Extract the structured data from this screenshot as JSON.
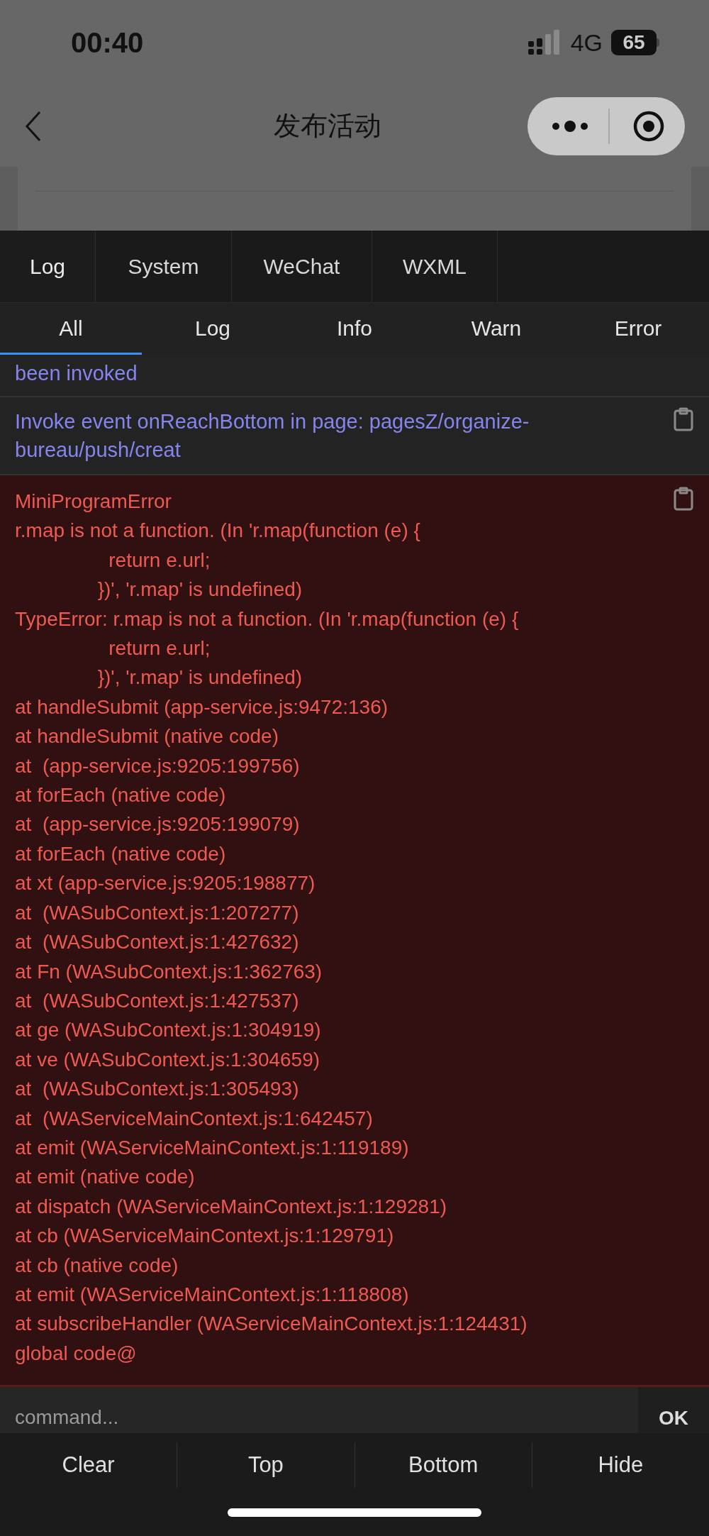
{
  "status_bar": {
    "time": "00:40",
    "network": "4G",
    "battery": "65"
  },
  "nav": {
    "title": "发布活动"
  },
  "tabs": [
    {
      "label": "Log",
      "selected": true
    },
    {
      "label": "System",
      "selected": false
    },
    {
      "label": "WeChat",
      "selected": false
    },
    {
      "label": "WXML",
      "selected": false
    }
  ],
  "filters": [
    {
      "label": "All",
      "selected": true
    },
    {
      "label": "Log",
      "selected": false
    },
    {
      "label": "Info",
      "selected": false
    },
    {
      "label": "Warn",
      "selected": false
    },
    {
      "label": "Error",
      "selected": false
    }
  ],
  "entries": [
    {
      "kind": "log",
      "text": "been invoked",
      "copy": false
    },
    {
      "kind": "log",
      "text": "Invoke event onReachBottom in page: pagesZ/organize-bureau/push/creat",
      "copy": true
    },
    {
      "kind": "error",
      "title": "MiniProgramError",
      "text": "r.map is not a function. (In 'r.map(function (e) {\n                 return e.url;\n               })', 'r.map' is undefined)\nTypeError: r.map is not a function. (In 'r.map(function (e) {\n                 return e.url;\n               })', 'r.map' is undefined)\nat handleSubmit (app-service.js:9472:136)\nat handleSubmit (native code)\nat  (app-service.js:9205:199756)\nat forEach (native code)\nat  (app-service.js:9205:199079)\nat forEach (native code)\nat xt (app-service.js:9205:198877)\nat  (WASubContext.js:1:207277)\nat  (WASubContext.js:1:427632)\nat Fn (WASubContext.js:1:362763)\nat  (WASubContext.js:1:427537)\nat ge (WASubContext.js:1:304919)\nat ve (WASubContext.js:1:304659)\nat  (WASubContext.js:1:305493)\nat  (WAServiceMainContext.js:1:642457)\nat emit (WAServiceMainContext.js:1:119189)\nat emit (native code)\nat dispatch (WAServiceMainContext.js:1:129281)\nat cb (WAServiceMainContext.js:1:129791)\nat cb (native code)\nat emit (WAServiceMainContext.js:1:118808)\nat subscribeHandler (WAServiceMainContext.js:1:124431)\nglobal code@",
      "copy": true
    }
  ],
  "command": {
    "placeholder": "command...",
    "button": "OK"
  },
  "actions": [
    "Clear",
    "Top",
    "Bottom",
    "Hide"
  ]
}
